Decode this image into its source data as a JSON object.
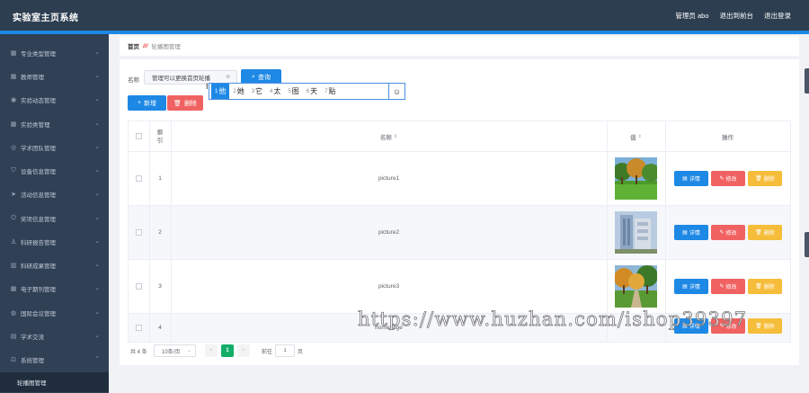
{
  "header": {
    "title": "实验室主页系统",
    "admin": "管理员 abo",
    "back_to_desk": "退出到前台",
    "logout": "退出登录"
  },
  "sidebar": {
    "items": [
      {
        "label": "专业类型管理",
        "icon": "grid-icon"
      },
      {
        "label": "教师管理",
        "icon": "grid-icon"
      },
      {
        "label": "实验动态管理",
        "icon": "location-icon"
      },
      {
        "label": "实验类管理",
        "icon": "grid-icon"
      },
      {
        "label": "学术团队管理",
        "icon": "compass-icon"
      },
      {
        "label": "设备信息管理",
        "icon": "shield-icon"
      },
      {
        "label": "活动信息管理",
        "icon": "send-icon"
      },
      {
        "label": "奖项信息管理",
        "icon": "power-icon"
      },
      {
        "label": "科研报告管理",
        "icon": "person-icon"
      },
      {
        "label": "科研成果管理",
        "icon": "bar-icon"
      },
      {
        "label": "电子期刊管理",
        "icon": "grid-icon"
      },
      {
        "label": "国际会议管理",
        "icon": "globe-icon"
      },
      {
        "label": "学术交流",
        "icon": "doc-icon"
      },
      {
        "label": "系统管理",
        "icon": "lock-icon"
      }
    ],
    "active_sub": "轮播图管理"
  },
  "breadcrumb": {
    "home": "首页",
    "separator": "///",
    "current": "轮播图管理"
  },
  "search": {
    "label": "名称",
    "value": "管理可以更换首页轮播",
    "query_button": "查询"
  },
  "ime": {
    "candidates": [
      {
        "n": "1",
        "text": "他"
      },
      {
        "n": "2",
        "text": "她"
      },
      {
        "n": "3",
        "text": "它"
      },
      {
        "n": "4",
        "text": "太"
      },
      {
        "n": "5",
        "text": "图"
      },
      {
        "n": "6",
        "text": "天"
      },
      {
        "n": "7",
        "text": "贴"
      }
    ],
    "emoji": "☺"
  },
  "actions": {
    "add": "新增",
    "delete": "删除"
  },
  "table": {
    "headers": {
      "index": "索引",
      "name": "名称",
      "value": "值",
      "ops": "操作"
    },
    "rows": [
      {
        "index": "1",
        "name": "picture1",
        "thumb": "park-trees"
      },
      {
        "index": "2",
        "name": "picture2",
        "thumb": "building"
      },
      {
        "index": "3",
        "name": "picture3",
        "thumb": "autumn-path"
      },
      {
        "index": "4",
        "name": "homepage",
        "thumb": ""
      }
    ],
    "op_labels": {
      "detail": "详情",
      "edit": "修改",
      "delete": "删除"
    }
  },
  "pagination": {
    "total": "共 4 条",
    "page_size": "10条/页",
    "prev": "<",
    "current": "1",
    "next": ">",
    "goto_label": "前往",
    "goto_value": "1",
    "unit": "页"
  },
  "watermark": "https://www.huzhan.com/ishop39397",
  "colors": {
    "header_bg": "#2d3e50",
    "accent": "#1e88e5",
    "danger": "#f06262",
    "warning": "#f6bd3a",
    "sidebar_bg": "#304156",
    "page_active": "#13ae67"
  }
}
